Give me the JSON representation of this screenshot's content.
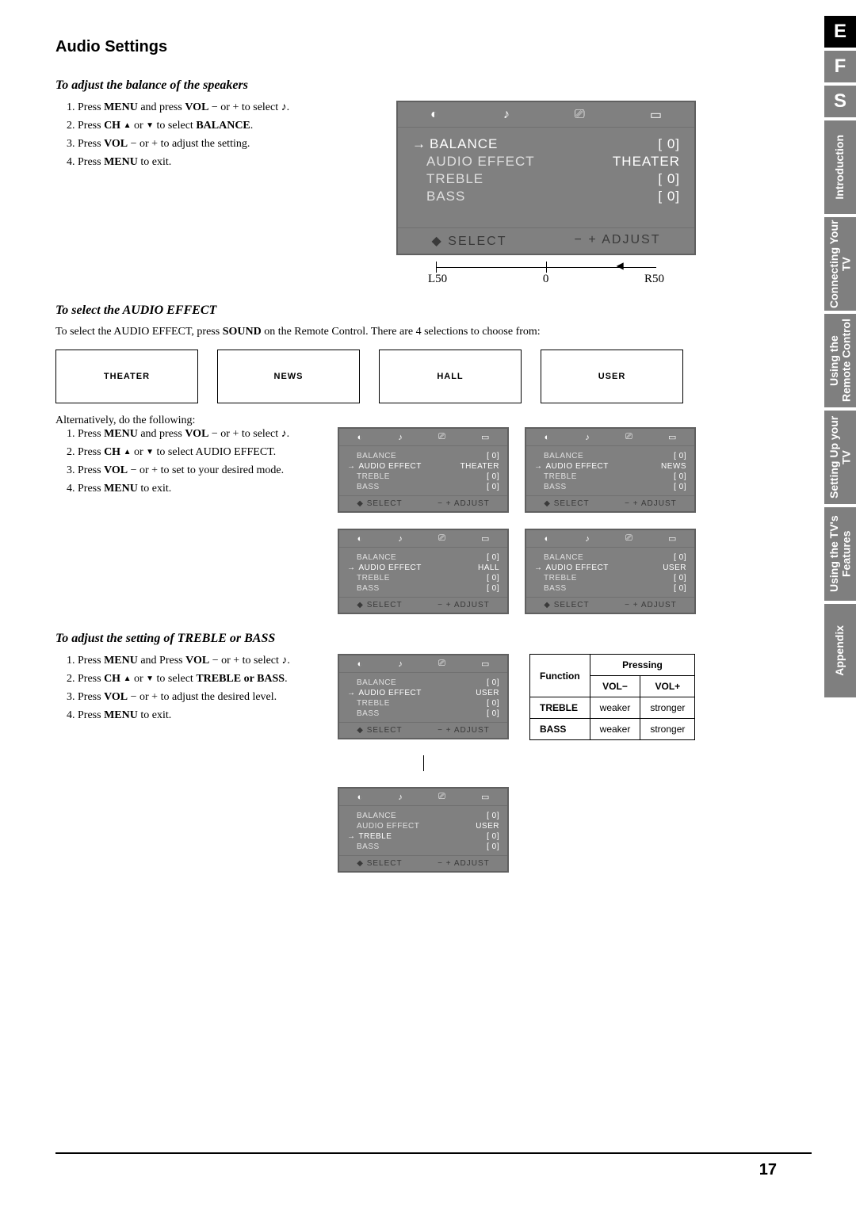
{
  "page_title": "Audio Settings",
  "page_number": "17",
  "side_tabs": {
    "letters": [
      "E",
      "F",
      "S"
    ],
    "selected_letter": 0,
    "sections": [
      {
        "label": "Introduction",
        "current": false
      },
      {
        "label": "Connecting Your TV",
        "current": false
      },
      {
        "label": "Using the Remote Control",
        "current": false
      },
      {
        "label": "Setting Up your TV",
        "current": false
      },
      {
        "label": "Using the TV's Features",
        "current": true
      },
      {
        "label": "Appendix",
        "current": false
      }
    ]
  },
  "section1": {
    "heading": "To adjust the balance of the speakers",
    "steps_html": [
      "Press <b>MENU</b> and press <b>VOL</b> − or + to select <span class='music-icon'>♪</span>.",
      "Press <b>CH</b> <span class='tri'>▲</span> or <span class='tri'>▼</span> to select <b>BALANCE</b>.",
      "Press <b>VOL</b> − or + to adjust the setting.",
      "Press <b>MENU</b> to exit."
    ],
    "osd": {
      "rows": [
        {
          "label": "BALANCE",
          "value": "[      0]",
          "sel": true
        },
        {
          "label": "AUDIO EFFECT",
          "value": "THEATER",
          "sel": false
        },
        {
          "label": "TREBLE",
          "value": "[      0]",
          "sel": false
        },
        {
          "label": "BASS",
          "value": "[      0]",
          "sel": false
        }
      ],
      "footer_left": "SELECT",
      "footer_right": "ADJUST"
    },
    "scale": {
      "left": "L50",
      "mid": "0",
      "right": "R50"
    }
  },
  "section2": {
    "heading": "To select the AUDIO EFFECT",
    "intro_html": "To select the AUDIO EFFECT, press <b>SOUND</b> on the Remote Control. There are 4 selections to choose from:",
    "effects": [
      "THEATER",
      "NEWS",
      "HALL",
      "USER"
    ],
    "alt_intro": "Alternatively, do the following:",
    "steps_html": [
      "Press <b>MENU</b> and press <b>VOL</b> − or + to select <span class='music-icon'>♪</span>.",
      "Press <b>CH</b> <span class='tri'>▲</span> or <span class='tri'>▼</span> to select AUDIO EFFECT.",
      "Press <b>VOL</b> − or + to set to your desired mode.",
      "Press <b>MENU</b> to exit."
    ],
    "osds": [
      {
        "effect": "THEATER"
      },
      {
        "effect": "NEWS"
      },
      {
        "effect": "HALL"
      },
      {
        "effect": "USER"
      }
    ],
    "osd_rows_common": {
      "balance": "BALANCE",
      "bal_val": "[    0]",
      "ae": "AUDIO EFFECT",
      "treble": "TREBLE",
      "treb_val": "[    0]",
      "bass": "BASS",
      "bass_val": "[    0]",
      "footer_left": "SELECT",
      "footer_right": "ADJUST"
    }
  },
  "section3": {
    "heading": "To adjust the setting of TREBLE or BASS",
    "steps_html": [
      "Press <b>MENU</b> and Press <b>VOL</b> − or + to select <span class='music-icon'>♪</span>.",
      "Press <b>CH</b> <span class='tri'>▲</span> or <span class='tri'>▼</span> to select <b>TREBLE or BASS</b>.",
      "Press <b>VOL</b> − or + to adjust the desired level.",
      "Press <b>MENU</b> to exit."
    ],
    "osd_a": {
      "rows": [
        {
          "label": "BALANCE",
          "value": "[    0]",
          "sel": false
        },
        {
          "label": "AUDIO EFFECT",
          "value": "USER",
          "sel": true
        },
        {
          "label": "TREBLE",
          "value": "[    0]",
          "sel": false
        },
        {
          "label": "BASS",
          "value": "[    0]",
          "sel": false
        }
      ]
    },
    "osd_b": {
      "rows": [
        {
          "label": "BALANCE",
          "value": "[    0]",
          "sel": false
        },
        {
          "label": "AUDIO EFFECT",
          "value": "USER",
          "sel": false
        },
        {
          "label": "TREBLE",
          "value": "[    0]",
          "sel": true
        },
        {
          "label": "BASS",
          "value": "[    0]",
          "sel": false
        }
      ]
    },
    "table": {
      "head_function": "Function",
      "head_pressing": "Pressing",
      "head_volminus": "VOL−",
      "head_volplus": "VOL+",
      "rows": [
        {
          "fn": "TREBLE",
          "minus": "weaker",
          "plus": "stronger"
        },
        {
          "fn": "BASS",
          "minus": "weaker",
          "plus": "stronger"
        }
      ]
    }
  },
  "osd_icons": [
    "◐",
    "♪",
    "⎚",
    "▭"
  ],
  "osd_footer_icons": {
    "select": "◆",
    "adjust": "− +"
  }
}
